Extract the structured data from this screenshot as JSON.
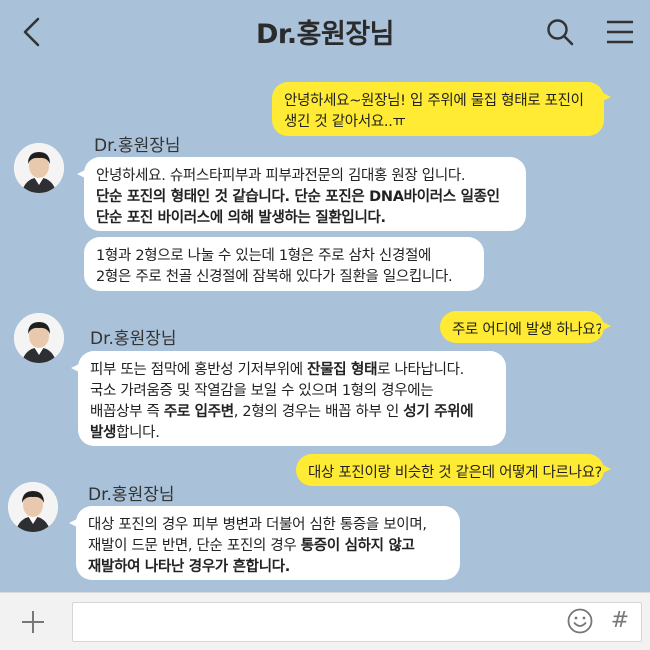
{
  "header": {
    "title": "Dr.홍원장님",
    "back_icon": "chevron-left-icon",
    "search_icon": "search-icon",
    "menu_icon": "hamburger-menu-icon"
  },
  "chat": {
    "sender_name": "Dr.홍원장님",
    "messages": [
      {
        "from": "me",
        "lines": [
          [
            {
              "t": "안녕하세요~원장님! 입 주위에 물집 형태로 포진이"
            }
          ],
          [
            {
              "t": "생긴 것 같아서요..ㅠ"
            }
          ]
        ]
      },
      {
        "from": "them",
        "lines": [
          [
            {
              "t": "안녕하세요. 슈퍼스타피부과 피부과전문의 김대홍 원장 입니다."
            }
          ],
          [
            {
              "t": "단순 포진의 형태인 것 같습니다. 단순 포진은 DNA바이러스 일종인",
              "b": true
            }
          ],
          [
            {
              "t": "단순 포진 바이러스에 의해 발생하는 질환입니다.",
              "b": true
            }
          ]
        ]
      },
      {
        "from": "them",
        "lines": [
          [
            {
              "t": "1형과 2형으로 나눌 수 있는데 1형은 주로 삼차 신경절에"
            }
          ],
          [
            {
              "t": "2형은 주로 천골 신경절에 잠복해 있다가 질환을 일으킵니다."
            }
          ]
        ]
      },
      {
        "from": "me",
        "lines": [
          [
            {
              "t": "주로 어디에 발생 하나요?"
            }
          ]
        ]
      },
      {
        "from": "them",
        "lines": [
          [
            {
              "t": "피부 또는 점막에 홍반성 기저부위에 "
            },
            {
              "t": "잔물집 형태",
              "b": true
            },
            {
              "t": "로 나타납니다."
            }
          ],
          [
            {
              "t": "국소 가려움증 및 작열감을 보일 수 있으며 1형의 경우에는"
            }
          ],
          [
            {
              "t": "배꼽상부 즉 "
            },
            {
              "t": "주로 입주변",
              "b": true
            },
            {
              "t": ", 2형의 경우는 배꼽 하부 인 "
            },
            {
              "t": "성기 주위에",
              "b": true
            }
          ],
          [
            {
              "t": "발생",
              "b": true
            },
            {
              "t": "합니다."
            }
          ]
        ]
      },
      {
        "from": "me",
        "lines": [
          [
            {
              "t": "대상 포진이랑 비슷한 것 같은데 어떻게 다르나요?"
            }
          ]
        ]
      },
      {
        "from": "them",
        "lines": [
          [
            {
              "t": "대상 포진의 경우 피부 병변과 더불어 심한 통증을 보이며,"
            }
          ],
          [
            {
              "t": "재발이 드문 반면, 단순 포진의 경우 "
            },
            {
              "t": "통증이 심하지 않고",
              "b": true
            }
          ],
          [
            {
              "t": "재발하여 나타난 경우가 흔합니다.",
              "b": true
            }
          ]
        ]
      }
    ]
  },
  "footer": {
    "plus_icon": "plus-icon",
    "input_value": "",
    "emoji_icon": "smiley-icon",
    "hash_label": "#"
  }
}
